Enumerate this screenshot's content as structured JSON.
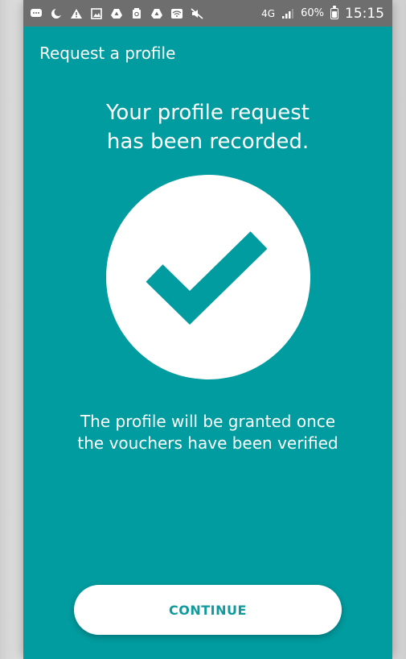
{
  "status_bar": {
    "network": "4G",
    "battery_percent": "60%",
    "time": "15:15",
    "icons": [
      "messages-icon",
      "moon-icon",
      "warning-icon",
      "image-icon",
      "drive-icon",
      "recycle-icon",
      "drive-icon",
      "wifi-icon",
      "mute-icon",
      "signal-icon",
      "battery-icon"
    ]
  },
  "header": {
    "title": "Request a profile"
  },
  "main": {
    "headline_line1": "Your profile request",
    "headline_line2": "has been recorded.",
    "message_line1": "The profile will be granted once",
    "message_line2": "the vouchers have been verified"
  },
  "actions": {
    "continue_label": "CONTINUE"
  },
  "colors": {
    "primary": "#009c9f",
    "status_bar": "#6e6e6e",
    "button_text": "#119a9c",
    "white": "#ffffff"
  }
}
